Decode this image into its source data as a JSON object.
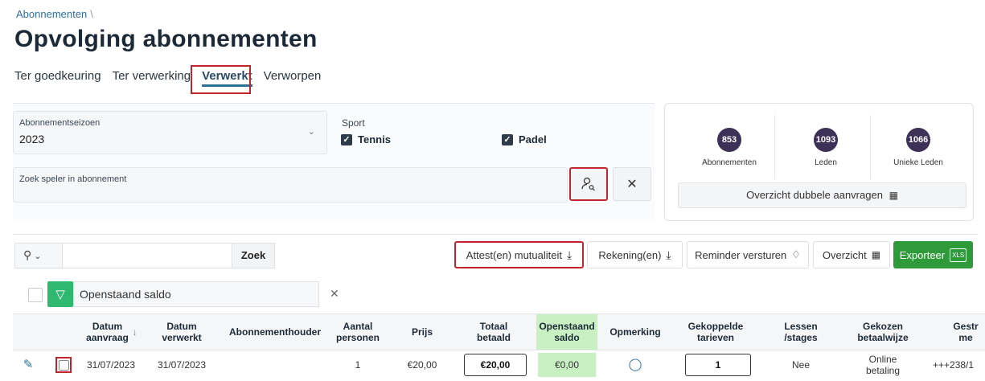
{
  "breadcrumb": {
    "item": "Abonnementen",
    "separator": "\\"
  },
  "page_title": "Opvolging abonnementen",
  "tabs": [
    {
      "label": "Ter goedkeuring"
    },
    {
      "label": "Ter verwerking"
    },
    {
      "label": "Verwerkt",
      "active": true
    },
    {
      "label": "Verworpen"
    }
  ],
  "filters": {
    "season_label": "Abonnementseizoen",
    "season_value": "2023",
    "sport_label": "Sport",
    "sport_options": [
      {
        "label": "Tennis",
        "checked": true
      },
      {
        "label": "Padel",
        "checked": true
      }
    ],
    "player_search_label": "Zoek speler in abonnement",
    "player_search_icon": "user-search-icon",
    "clear_icon": "close-icon"
  },
  "stats": {
    "items": [
      {
        "value": "853",
        "label": "Abonnementen"
      },
      {
        "value": "1093",
        "label": "Leden"
      },
      {
        "value": "1066",
        "label": "Unieke Leden"
      }
    ],
    "dubbel_button": "Overzicht dubbele aanvragen"
  },
  "toolbar": {
    "search_button": "Zoek",
    "attest_button": "Attest(en) mutualiteit",
    "rekening_button": "Rekening(en)",
    "reminder_button": "Reminder versturen",
    "overzicht_button": "Overzicht",
    "export_button": "Exporteer",
    "export_badge": "XLS"
  },
  "active_filter": {
    "label": "Openstaand saldo"
  },
  "table": {
    "headers": {
      "datum_aanvraag": "Datum aanvraag",
      "datum_verwerkt": "Datum verwerkt",
      "abonnementhouder": "Abonnementhouder",
      "aantal_personen": "Aantal personen",
      "prijs": "Prijs",
      "totaal_betaald": "Totaal betaald",
      "openstaand_saldo": "Openstaand saldo",
      "opmerking": "Opmerking",
      "gekoppelde_tarieven": "Gekoppelde tarieven",
      "lessen_stages": "Lessen /stages",
      "gekozen_betaalwijze": "Gekozen betaalwijze",
      "gestr_me": "Gestr me"
    },
    "rows": [
      {
        "datum_aanvraag": "31/07/2023",
        "datum_verwerkt": "31/07/2023",
        "abonnementhouder": "",
        "aantal_personen": "1",
        "prijs": "€20,00",
        "totaal_betaald": "€20,00",
        "openstaand_saldo": "€0,00",
        "gekoppelde_tarieven": "1",
        "lessen_stages": "Nee",
        "gekozen_betaalwijze": "Online betaling",
        "gestr_me": "+++238/1"
      }
    ]
  },
  "colors": {
    "accent_red": "#c0262c",
    "export_green": "#2e9a3a",
    "stat_circle": "#3d3158",
    "saldo_green": "#c9f0c2"
  }
}
